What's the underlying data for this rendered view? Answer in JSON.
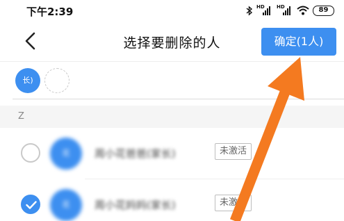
{
  "status_bar": {
    "time": "下午2:39",
    "signal_label": "HD",
    "battery": "89",
    "icons": [
      "bluetooth-icon",
      "signal-hd-icon",
      "signal-hd-icon",
      "wifi-icon",
      "battery-icon"
    ]
  },
  "header": {
    "back_icon": "chevron-left-icon",
    "title": "选择要删除的人",
    "confirm_label": "确定(1人)"
  },
  "selected": {
    "chip_text": "长)"
  },
  "section": {
    "letter": "Z"
  },
  "members": [
    {
      "avatar_text": "花",
      "name": "周小花爸爸(家长)",
      "status": "未激活",
      "checked": false
    },
    {
      "avatar_text": "花",
      "name": "周小花妈妈(家长)",
      "status": "未激活",
      "checked": true
    }
  ],
  "colors": {
    "accent": "#3d8ff0",
    "annotation_arrow": "#f47a20"
  }
}
